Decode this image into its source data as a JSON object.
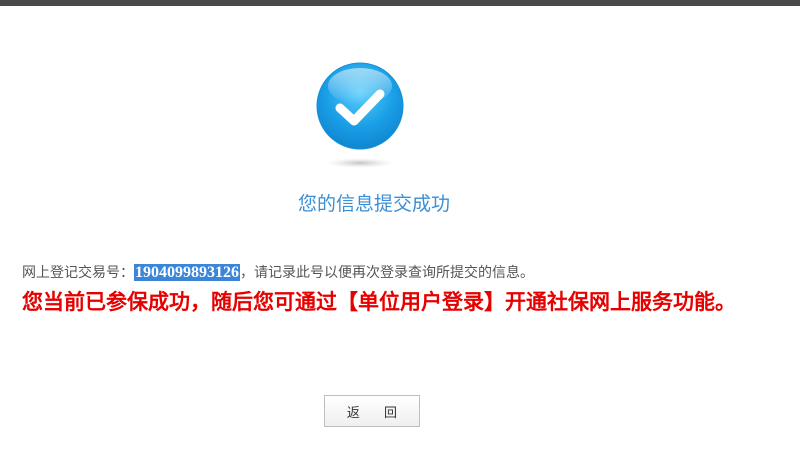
{
  "result": {
    "title": "您的信息提交成功"
  },
  "transaction": {
    "prefix": "网上登记交易号：",
    "number": "1904099893126",
    "suffix": "，请记录此号以便再次登录查询所提交的信息。"
  },
  "notice": {
    "text": "您当前已参保成功，随后您可通过【单位用户登录】开通社保网上服务功能。"
  },
  "actions": {
    "back_label": "返 回"
  },
  "colors": {
    "title": "#3a8fd6",
    "notice": "#e60000",
    "highlight": "#3b86d8",
    "icon_blue": "#1a9fe6"
  },
  "icons": {
    "success": "check-circle-icon"
  }
}
